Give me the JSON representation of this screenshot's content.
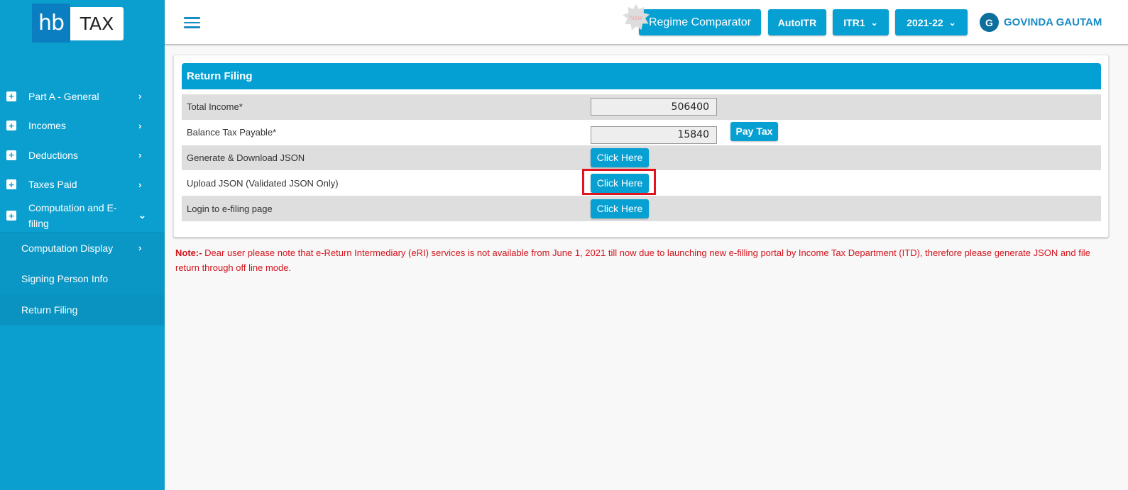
{
  "logo": {
    "part1": "hb",
    "part2": "TAX"
  },
  "sidebar": {
    "items": [
      {
        "label": "Part A - General",
        "chevron": "›"
      },
      {
        "label": "Incomes",
        "chevron": "›"
      },
      {
        "label": "Deductions",
        "chevron": "›"
      },
      {
        "label": "Taxes Paid",
        "chevron": "›"
      },
      {
        "label": "Computation and E-filing",
        "chevron": "⌄"
      }
    ],
    "subitems": [
      {
        "label": "Computation Display",
        "chevron": "›"
      },
      {
        "label": "Signing Person Info"
      },
      {
        "label": "Return Filing"
      }
    ],
    "plus_glyph": "+"
  },
  "header": {
    "new_badge": "New",
    "regime_label": "Regime Comparator",
    "autoitr_label": "AutoITR",
    "itr_select": "ITR1",
    "year_select": "2021-22",
    "caret": "⌄",
    "user_initial": "G",
    "user_name": "GOVINDA GAUTAM"
  },
  "card": {
    "title": "Return Filing",
    "rows": [
      {
        "label": "Total Income*",
        "value": "506400"
      },
      {
        "label": "Balance Tax Payable*",
        "value": "15840",
        "button": "Pay Tax"
      },
      {
        "label": "Generate & Download JSON",
        "button": "Click Here"
      },
      {
        "label": "Upload JSON (Validated JSON Only)",
        "button": "Click Here"
      },
      {
        "label": "Login to e-filing page",
        "button": "Click Here"
      }
    ]
  },
  "note": {
    "prefix": "Note:-",
    "text": " Dear user please note that e-Return Intermediary (eRI) services is not available from June 1, 2021 till now due to launching new e-filling portal by Income Tax Department (ITD), therefore please generate JSON and file return through off line mode."
  },
  "colors": {
    "primary": "#07a0d2",
    "sidebar": "#0b9fd0",
    "note": "#d2141c",
    "highlight": "#e3141e"
  }
}
